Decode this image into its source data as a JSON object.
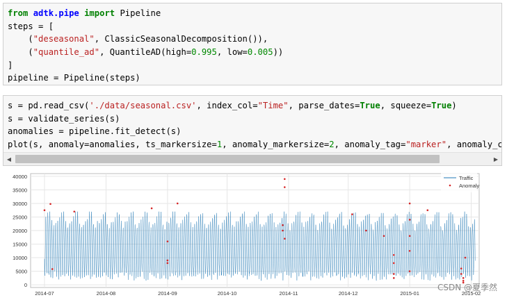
{
  "cell1": {
    "lines": [
      [
        {
          "t": "from",
          "c": "kw"
        },
        {
          "t": " "
        },
        {
          "t": "adtk.pipe",
          "c": "mod"
        },
        {
          "t": " "
        },
        {
          "t": "import",
          "c": "kw"
        },
        {
          "t": " Pipeline"
        }
      ],
      [
        {
          "t": "steps = ["
        }
      ],
      [
        {
          "t": "    ("
        },
        {
          "t": "\"deseasonal\"",
          "c": "str"
        },
        {
          "t": ", ClassicSeasonalDecomposition()),"
        }
      ],
      [
        {
          "t": "    ("
        },
        {
          "t": "\"quantile_ad\"",
          "c": "str"
        },
        {
          "t": ", QuantileAD(high="
        },
        {
          "t": "0.995",
          "c": "num"
        },
        {
          "t": ", low="
        },
        {
          "t": "0.005",
          "c": "num"
        },
        {
          "t": "))"
        }
      ],
      [
        {
          "t": "]"
        }
      ],
      [
        {
          "t": "pipeline = Pipeline(steps)"
        }
      ]
    ]
  },
  "cell2": {
    "lines": [
      [
        {
          "t": "s = pd.read_csv("
        },
        {
          "t": "'./data/seasonal.csv'",
          "c": "str"
        },
        {
          "t": ", index_col="
        },
        {
          "t": "\"Time\"",
          "c": "str"
        },
        {
          "t": ", parse_dates="
        },
        {
          "t": "True",
          "c": "kwc"
        },
        {
          "t": ", squeeze="
        },
        {
          "t": "True",
          "c": "kwc"
        },
        {
          "t": ")"
        }
      ],
      [
        {
          "t": "s = validate_series(s)"
        }
      ],
      [
        {
          "t": "anomalies = pipeline.fit_detect(s)"
        }
      ],
      [
        {
          "t": "plot(s, anomaly=anomalies, ts_markersize="
        },
        {
          "t": "1",
          "c": "num"
        },
        {
          "t": ", anomaly_markersize="
        },
        {
          "t": "2",
          "c": "num"
        },
        {
          "t": ", anomaly_tag="
        },
        {
          "t": "\"marker\"",
          "c": "str"
        },
        {
          "t": ", anomaly_co"
        }
      ]
    ],
    "scroll_left_icon": "triangle-left-icon",
    "scroll_right_icon": "triangle-right-icon",
    "scroll_left_glyph": "◀",
    "scroll_right_glyph": "▶"
  },
  "chart_data": {
    "type": "line",
    "ylim": [
      -1000,
      41000
    ],
    "yticks": [
      0,
      5000,
      10000,
      15000,
      20000,
      25000,
      30000,
      35000,
      40000
    ],
    "xticks": [
      "2014-07",
      "2014-08",
      "2014-09",
      "2014-10",
      "2014-11",
      "2014-12",
      "2015-01",
      "2015-02"
    ],
    "xtick_dates": [
      "2014-07-01",
      "2014-08-01",
      "2014-09-01",
      "2014-10-01",
      "2014-11-01",
      "2014-12-01",
      "2015-01-01",
      "2015-02-01"
    ],
    "xlim": [
      "2014-06-24",
      "2015-02-05"
    ],
    "grid": true,
    "legend_placement": "top-right",
    "series": [
      {
        "name": "Traffic",
        "color": "#1f77b4",
        "style": "line",
        "daily_low_range": [
          1500,
          5000
        ],
        "daily_high_range": [
          17000,
          27000
        ],
        "start": "2014-07-01",
        "end": "2015-02-03"
      },
      {
        "name": "Anomaly",
        "color": "#d62728",
        "style": "marker",
        "points": [
          [
            "2014-07-01",
            27500
          ],
          [
            "2014-07-04",
            29800
          ],
          [
            "2014-07-05",
            5800
          ],
          [
            "2014-07-16",
            27000
          ],
          [
            "2014-08-24",
            28200
          ],
          [
            "2014-09-01",
            16000
          ],
          [
            "2014-09-01",
            9000
          ],
          [
            "2014-09-01",
            8000
          ],
          [
            "2014-09-06",
            30000
          ],
          [
            "2014-10-30",
            39000
          ],
          [
            "2014-10-30",
            36000
          ],
          [
            "2014-10-29",
            22000
          ],
          [
            "2014-10-29",
            20000
          ],
          [
            "2014-10-30",
            17000
          ],
          [
            "2014-12-03",
            26000
          ],
          [
            "2014-12-10",
            20000
          ],
          [
            "2014-12-19",
            18000
          ],
          [
            "2014-12-24",
            11000
          ],
          [
            "2014-12-24",
            8000
          ],
          [
            "2014-12-24",
            4000
          ],
          [
            "2014-12-24",
            2500
          ],
          [
            "2015-01-01",
            30000
          ],
          [
            "2015-01-01",
            24000
          ],
          [
            "2015-01-01",
            18000
          ],
          [
            "2015-01-01",
            12500
          ],
          [
            "2015-01-01",
            5000
          ],
          [
            "2015-01-10",
            27500
          ],
          [
            "2015-01-27",
            6000
          ],
          [
            "2015-01-27",
            4000
          ],
          [
            "2015-01-28",
            2500
          ],
          [
            "2015-01-28",
            1500
          ],
          [
            "2015-01-28",
            800
          ],
          [
            "2015-01-29",
            10000
          ]
        ]
      }
    ]
  },
  "watermark": "CSDN @夏季然"
}
